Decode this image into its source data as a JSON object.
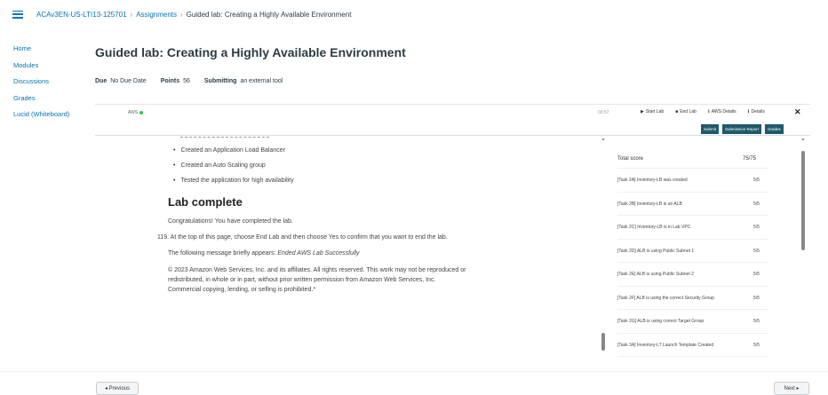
{
  "breadcrumb": {
    "course": "ACAv3EN-US-LTI13-125701",
    "assignments": "Assignments",
    "current": "Guided lab: Creating a Highly Available Environment"
  },
  "sidebar": {
    "items": [
      {
        "label": "Home"
      },
      {
        "label": "Modules"
      },
      {
        "label": "Discussions"
      },
      {
        "label": "Grades"
      },
      {
        "label": "Lucid (Whiteboard)"
      }
    ]
  },
  "page": {
    "title": "Guided lab: Creating a Highly Available Environment",
    "due_label": "Due",
    "due_value": "No Due Date",
    "points_label": "Points",
    "points_value": "56",
    "submitting_label": "Submitting",
    "submitting_value": "an external tool"
  },
  "lab": {
    "aws_label": "AWS",
    "timer": "00:57",
    "toolbar": {
      "start_lab": "Start Lab",
      "end_lab": "End Lab",
      "aws_details": "AWS Details",
      "details": "Details"
    },
    "buttons": {
      "submit": "Submit",
      "submission_report": "Submission Report",
      "grades": "Grades"
    },
    "bullets": [
      "Created an Application Load Balancer",
      "Created an Auto Scaling group",
      "Tested the application for high availability"
    ],
    "heading": "Lab complete",
    "congrats": "Congratulations! You have completed the lab.",
    "step": "119. At the top of this page, choose End Lab and then choose Yes to confirm that you want to end the lab.",
    "message_prefix": "The following message briefly appears: ",
    "message_em": "Ended AWS Lab Successfully",
    "copyright_1": "© 2023 Amazon Web Services, Inc. and its affiliates. All rights reserved. This work may not be reproduced or",
    "copyright_2": "redistributed, in whole or in part, without prior written permission from Amazon Web Services, Inc.",
    "copyright_3": "Commercial copying, lending, or selling is prohibited.*"
  },
  "score": {
    "total_label": "Total score",
    "total_value": "75/75",
    "rows": [
      {
        "task": "[Task 2A] Inventory-LB was created",
        "score": "5/5"
      },
      {
        "task": "[Task 2B] Inventory-LB is an ALB",
        "score": "5/5"
      },
      {
        "task": "[Task 2C] Inventory-LB is in Lab VPC",
        "score": "5/5"
      },
      {
        "task": "[Task 2D] ALB is using Public Subnet 1",
        "score": "5/5"
      },
      {
        "task": "[Task 2E] ALB is using Public Subnet 2",
        "score": "5/5"
      },
      {
        "task": "[Task 2F] ALB is using the correct Security Group",
        "score": "5/5"
      },
      {
        "task": "[Task 2G] ALB is using correct Target Group",
        "score": "5/5"
      },
      {
        "task": "[Task 3A] Inventory-LT Launch Template Created",
        "score": "5/5"
      }
    ]
  },
  "footer": {
    "previous": "◂ Previous",
    "next": "Next ▸"
  }
}
